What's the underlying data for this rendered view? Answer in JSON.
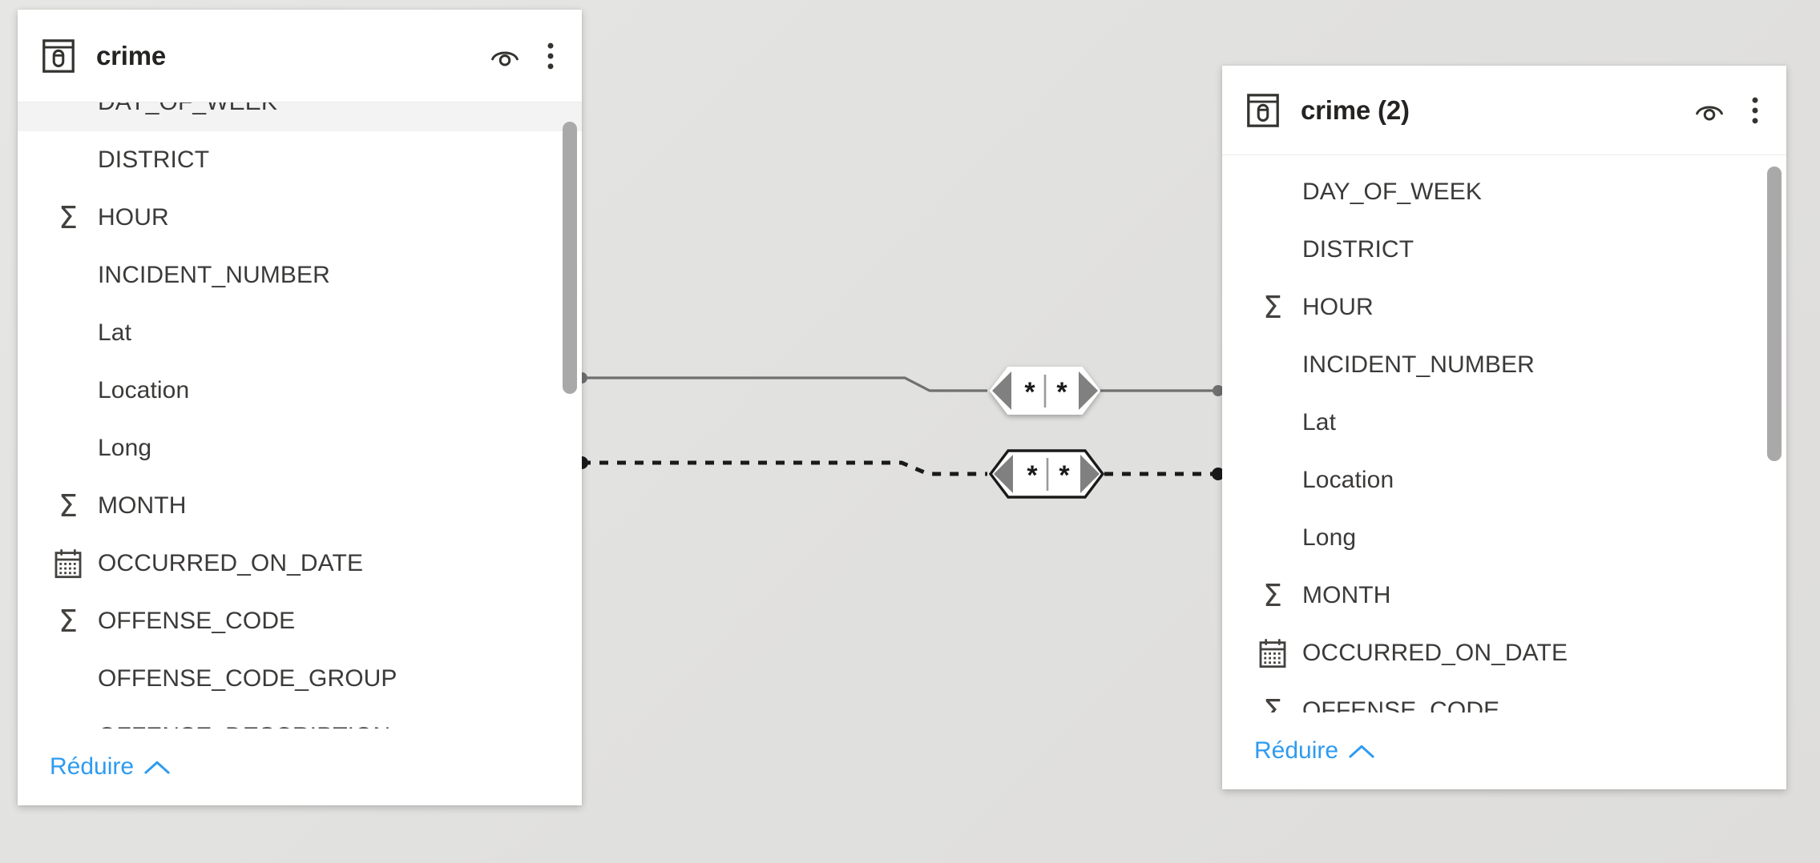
{
  "canvas": {
    "background_color": "#e2e1df",
    "accent_color": "#2e9bf0",
    "text_color": "#3b3a39",
    "card_background": "#ffffff",
    "highlight_row_color": "#f3f3f3",
    "scrollbar_color": "#a9a9a9",
    "line_color": "#707070"
  },
  "tables": [
    {
      "id": "crime",
      "title": "crime",
      "table_icon": "table-icon",
      "preview_icon": "eye-preview-icon",
      "menu_icon": "more-options-icon",
      "collapse_label": "Réduire",
      "collapse_icon": "chevron-up-icon",
      "scroll_thumb": {
        "top_pct": 6,
        "height_pct": 40
      },
      "fields": [
        {
          "name": "DAY_OF_WEEK",
          "icon": "none",
          "highlight": true,
          "clipped": "top"
        },
        {
          "name": "DISTRICT",
          "icon": "none",
          "highlight": false
        },
        {
          "name": "HOUR",
          "icon": "sum",
          "highlight": false
        },
        {
          "name": "INCIDENT_NUMBER",
          "icon": "none",
          "highlight": false
        },
        {
          "name": "Lat",
          "icon": "none",
          "highlight": false
        },
        {
          "name": "Location",
          "icon": "none",
          "highlight": false
        },
        {
          "name": "Long",
          "icon": "none",
          "highlight": false
        },
        {
          "name": "MONTH",
          "icon": "sum",
          "highlight": false
        },
        {
          "name": "OCCURRED_ON_DATE",
          "icon": "calendar",
          "highlight": false
        },
        {
          "name": "OFFENSE_CODE",
          "icon": "sum",
          "highlight": false
        },
        {
          "name": "OFFENSE_CODE_GROUP",
          "icon": "none",
          "highlight": false
        },
        {
          "name": "OFFENSE_DESCRIPTION",
          "icon": "none",
          "highlight": false,
          "clipped": "bottom"
        }
      ]
    },
    {
      "id": "crime2",
      "title": "crime (2)",
      "table_icon": "table-icon",
      "preview_icon": "eye-preview-icon",
      "menu_icon": "more-options-icon",
      "collapse_label": "Réduire",
      "collapse_icon": "chevron-up-icon",
      "scroll_thumb": {
        "top_pct": 2,
        "height_pct": 57
      },
      "fields": [
        {
          "name": "DAY_OF_WEEK",
          "icon": "none",
          "highlight": false
        },
        {
          "name": "DISTRICT",
          "icon": "none",
          "highlight": false
        },
        {
          "name": "HOUR",
          "icon": "sum",
          "highlight": false
        },
        {
          "name": "INCIDENT_NUMBER",
          "icon": "none",
          "highlight": false
        },
        {
          "name": "Lat",
          "icon": "none",
          "highlight": false
        },
        {
          "name": "Location",
          "icon": "none",
          "highlight": false
        },
        {
          "name": "Long",
          "icon": "none",
          "highlight": false
        },
        {
          "name": "MONTH",
          "icon": "sum",
          "highlight": false
        },
        {
          "name": "OCCURRED_ON_DATE",
          "icon": "calendar",
          "highlight": false
        },
        {
          "name": "OFFENSE_CODE",
          "icon": "sum",
          "highlight": false,
          "clipped": "bottom"
        }
      ]
    }
  ],
  "relationships": [
    {
      "id": "rel-active",
      "style": "solid",
      "state": "active",
      "left_cardinality": "*",
      "right_cardinality": "*",
      "from_table": "crime",
      "to_table": "crime (2)"
    },
    {
      "id": "rel-inactive",
      "style": "dotted",
      "state": "inactive",
      "left_cardinality": "*",
      "right_cardinality": "*",
      "from_table": "crime",
      "to_table": "crime (2)"
    }
  ]
}
